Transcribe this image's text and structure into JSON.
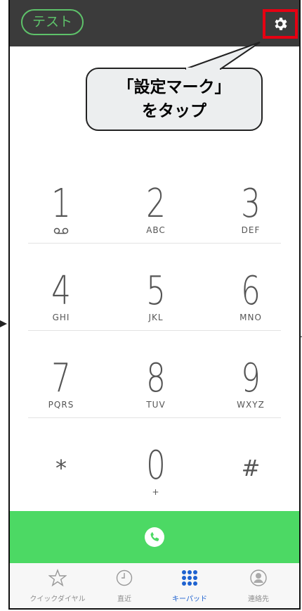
{
  "topbar": {
    "test_label": "テスト"
  },
  "callout": {
    "line1": "「設定マーク」",
    "line2": "をタップ"
  },
  "keypad": [
    [
      {
        "digit": "1",
        "letters": "",
        "voicemail": true
      },
      {
        "digit": "2",
        "letters": "ABC"
      },
      {
        "digit": "3",
        "letters": "DEF"
      }
    ],
    [
      {
        "digit": "4",
        "letters": "GHI"
      },
      {
        "digit": "5",
        "letters": "JKL"
      },
      {
        "digit": "6",
        "letters": "MNO"
      }
    ],
    [
      {
        "digit": "7",
        "letters": "PQRS"
      },
      {
        "digit": "8",
        "letters": "TUV"
      },
      {
        "digit": "9",
        "letters": "WXYZ"
      }
    ],
    [
      {
        "digit": "*",
        "letters": ""
      },
      {
        "digit": "0",
        "letters": "+"
      },
      {
        "digit": "#",
        "letters": ""
      }
    ]
  ],
  "tabs": [
    {
      "label": "クイックダイヤル",
      "icon": "star-icon"
    },
    {
      "label": "直近",
      "icon": "clock-icon"
    },
    {
      "label": "キーパッド",
      "icon": "keypad-grid-icon",
      "active": true
    },
    {
      "label": "連絡先",
      "icon": "contact-icon"
    }
  ],
  "colors": {
    "accent_green": "#4cd964",
    "highlight_red": "#e60012",
    "tab_active": "#1e62d0",
    "topbar": "#3b3b3b"
  }
}
